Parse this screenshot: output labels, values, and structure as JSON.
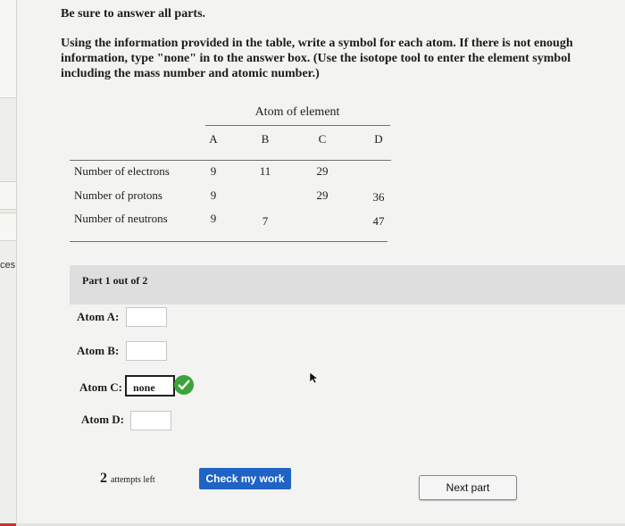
{
  "sidebar": {
    "label": "ces"
  },
  "heading": "Be sure to answer all parts.",
  "instructions": "Using the information provided in the table, write a symbol for each atom. If there is not enough information, type \"none\" in to the answer box. (Use the isotope tool to enter the element symbol including the mass number and atomic number.)",
  "table": {
    "group_header": "Atom of element",
    "columns": [
      "A",
      "B",
      "C",
      "D"
    ],
    "rows": [
      {
        "label": "Number of electrons",
        "values": [
          "9",
          "11",
          "29",
          ""
        ]
      },
      {
        "label": "Number of protons",
        "values": [
          "9",
          "",
          "29",
          "36"
        ]
      },
      {
        "label": "Number of neutrons",
        "values": [
          "9",
          "7",
          "",
          "47"
        ]
      }
    ]
  },
  "part": {
    "label": "Part 1 out of 2"
  },
  "answers": {
    "a": {
      "label": "Atom A:",
      "value": ""
    },
    "b": {
      "label": "Atom B:",
      "value": ""
    },
    "c": {
      "label": "Atom C:",
      "value": "none"
    },
    "d": {
      "label": "Atom D:",
      "value": ""
    }
  },
  "footer": {
    "attempts_count": "2",
    "attempts_text": "attempts left",
    "check_label": "Check my work",
    "next_label": "Next part"
  },
  "colors": {
    "check_button": "#1f63c6",
    "correct": "#3aa33a"
  },
  "icons": {
    "correct": "check-circle-icon",
    "cursor": "mouse-pointer-icon"
  }
}
